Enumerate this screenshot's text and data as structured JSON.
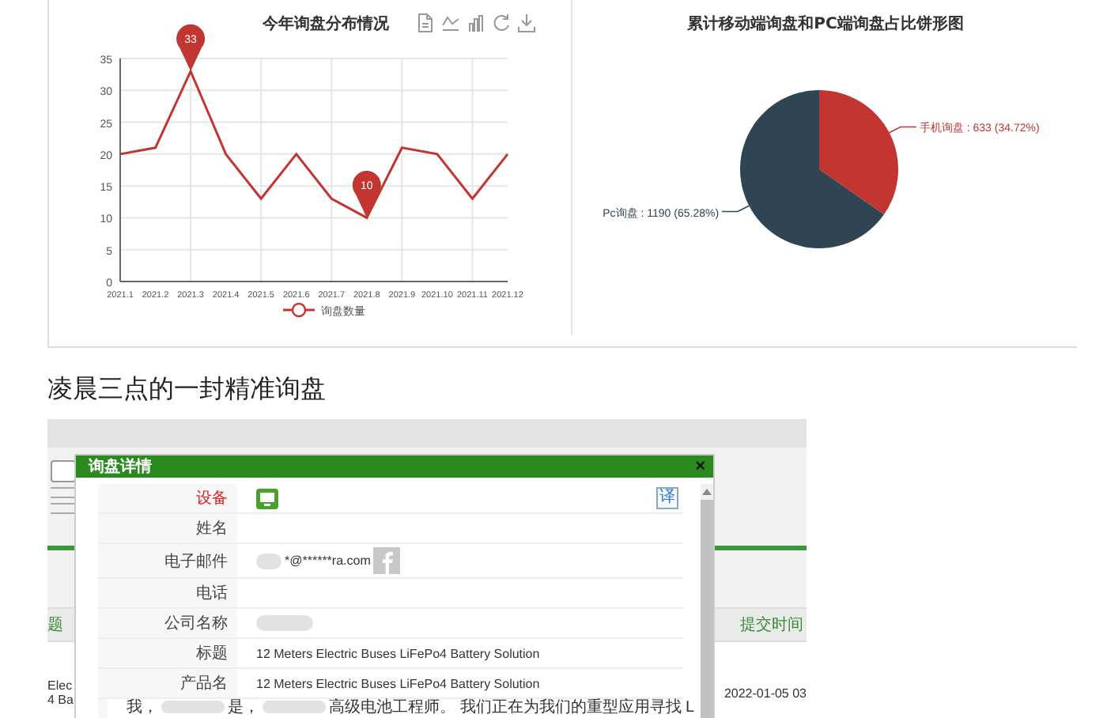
{
  "line_panel": {
    "chart_data": {
      "type": "line",
      "title": "今年询盘分布情况",
      "categories": [
        "2021.1",
        "2021.2",
        "2021.3",
        "2021.4",
        "2021.5",
        "2021.6",
        "2021.7",
        "2021.8",
        "2021.9",
        "2021.10",
        "2021.11",
        "2021.12"
      ],
      "yticks": [
        0,
        5,
        10,
        15,
        20,
        25,
        30,
        35
      ],
      "ylim": [
        0,
        35
      ],
      "grid": true,
      "series": [
        {
          "name": "询盘数量",
          "color": "#c23531",
          "values": [
            20,
            21,
            33,
            20,
            13,
            20,
            13,
            10,
            21,
            20,
            13,
            20
          ]
        }
      ],
      "annotations": [
        {
          "text": "33",
          "x": "2021.3",
          "y": 33
        },
        {
          "text": "10",
          "x": "2021.8",
          "y": 10
        }
      ]
    }
  },
  "pie_panel": {
    "chart_data": {
      "type": "pie",
      "title": "累计移动端询盘和PC端询盘占比饼形图",
      "series": [
        {
          "values": [
            34.72,
            65.28
          ],
          "colors": [
            "#c23531",
            "#2f4554"
          ]
        }
      ],
      "value_labels": [
        "手机询盘 : 633 (34.72%)",
        "Pc询盘 : 1190 (65.28%)"
      ]
    }
  },
  "section_heading": "凌晨三点的一封精准询盘",
  "screenshot": {
    "background": {
      "checkbox": {
        "checked": false
      },
      "column_1_header": "题",
      "column_1_cell_lines": [
        "Elec",
        "4 Ba"
      ],
      "submit_time_header": "提交时间",
      "submit_time_cell": "2022-01-05 03"
    },
    "dialog": {
      "title": "询盘详情",
      "close": "×",
      "translate_button": "译",
      "rows": [
        {
          "kind": "device",
          "label": "设备"
        },
        {
          "kind": "text",
          "label": "姓名"
        },
        {
          "kind": "email",
          "label": "电子邮件",
          "value": "*@******ra.com"
        },
        {
          "kind": "text",
          "label": "电话"
        },
        {
          "kind": "blurred",
          "label": "公司名称"
        },
        {
          "kind": "text",
          "label": "标题",
          "value": "12 Meters Electric Buses LiFePo4 Battery Solution"
        },
        {
          "kind": "text",
          "label": "产品名",
          "value": "12 Meters Electric Buses LiFePo4 Battery Solution"
        },
        {
          "kind": "content",
          "segments": [
            "我，",
            "是，",
            "高级电池工程师。 我们正在为我们的重型应用寻找 L"
          ]
        }
      ]
    }
  }
}
